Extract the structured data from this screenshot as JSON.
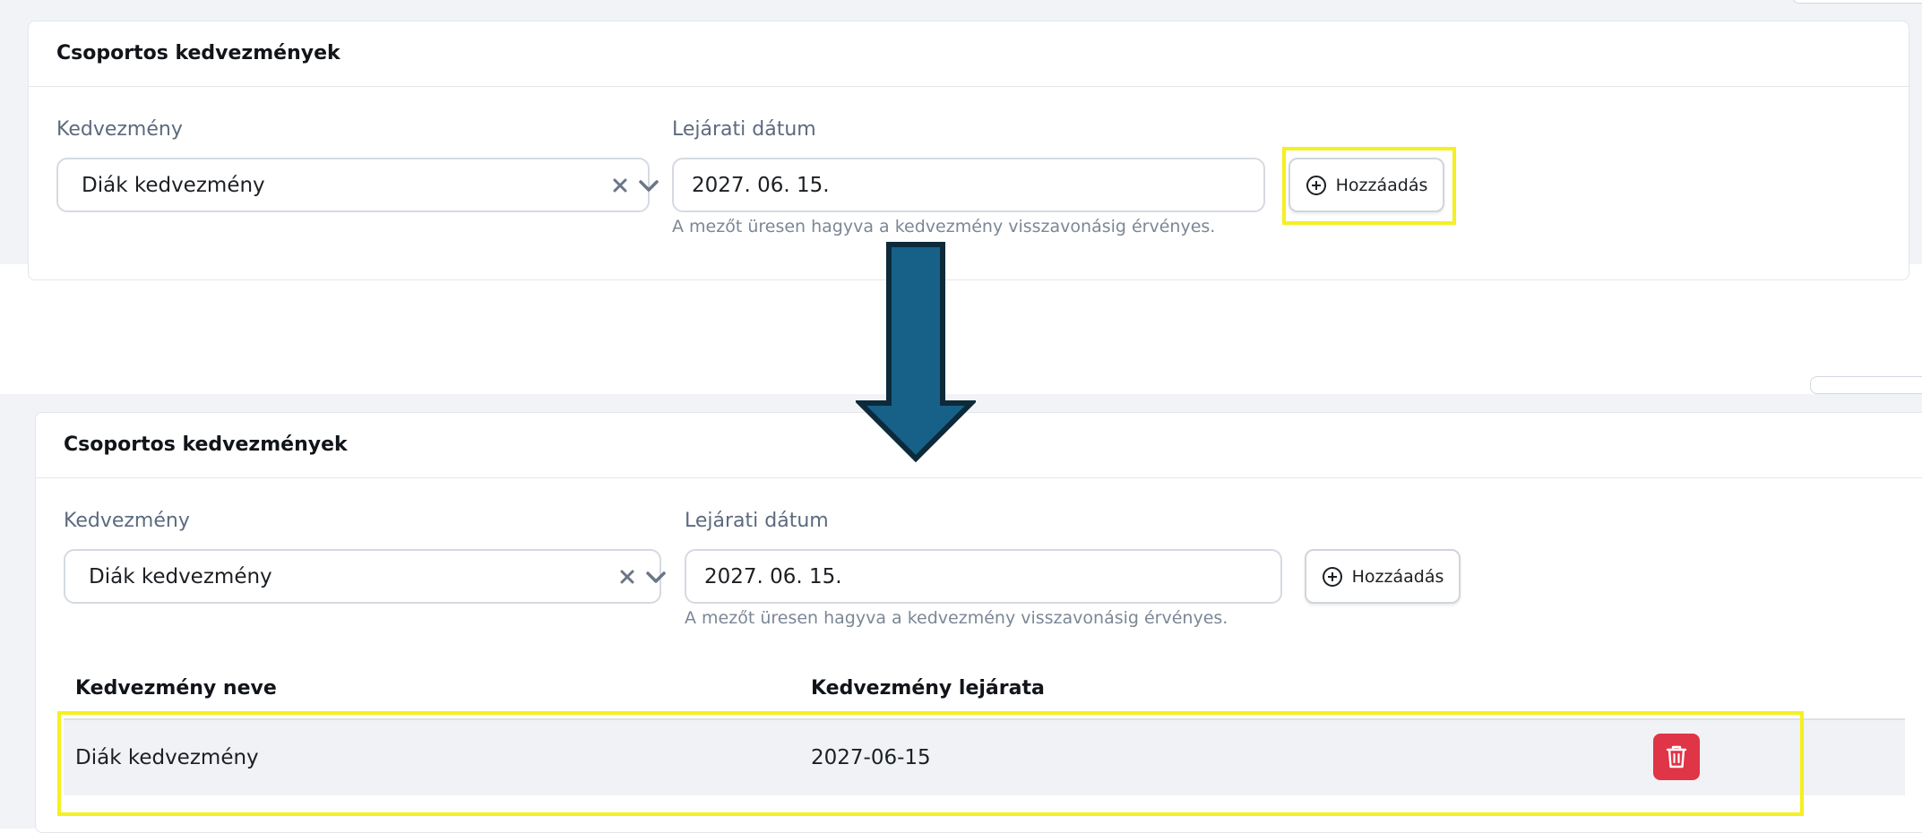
{
  "colors": {
    "page_bg": "#f1f3f6",
    "highlight": "#f5f01f",
    "arrow_fill": "#176188",
    "arrow_stroke": "#0d2a3a",
    "danger": "#e03447",
    "label": "#5c6a7e",
    "hint": "#7b8796"
  },
  "before": {
    "card_title": "Csoportos kedvezmények",
    "discount_label": "Kedvezmény",
    "discount_value": "Diák kedvezmény",
    "expiry_label": "Lejárati dátum",
    "expiry_value": "2027. 06. 15.",
    "add_button": "Hozzáadás",
    "hint": "A mezőt üresen hagyva a kedvezmény visszavonásig érvényes."
  },
  "after": {
    "card_title": "Csoportos kedvezmények",
    "discount_label": "Kedvezmény",
    "discount_value": "Diák kedvezmény",
    "expiry_label": "Lejárati dátum",
    "expiry_value": "2027. 06. 15.",
    "add_button": "Hozzáadás",
    "hint": "A mezőt üresen hagyva a kedvezmény visszavonásig érvényes.",
    "table": {
      "headers": [
        "Kedvezmény neve",
        "Kedvezmény lejárata"
      ],
      "rows": [
        [
          "Diák kedvezmény",
          "2027-06-15"
        ]
      ]
    }
  },
  "icons": {
    "clear": "close-icon",
    "dropdown": "chevron-down-icon",
    "add": "plus-circle-icon",
    "delete": "trash-icon",
    "transition": "arrow-down-icon"
  }
}
